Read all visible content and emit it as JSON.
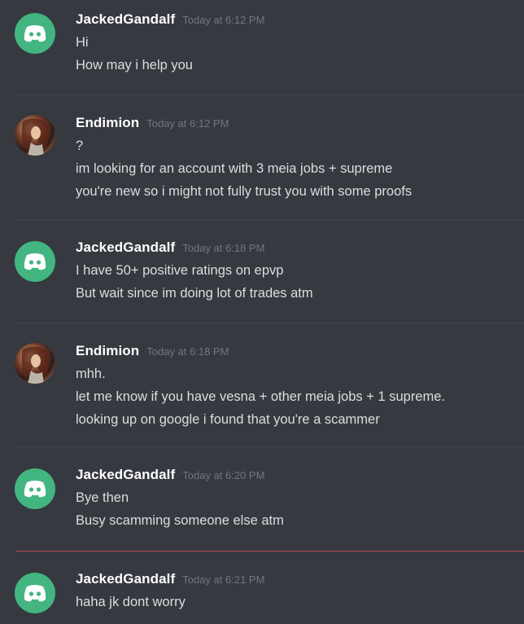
{
  "messages": [
    {
      "author": "JackedGandalf",
      "timestamp": "Today at 6:12 PM",
      "avatar": "discord-logo-icon",
      "lines": [
        "Hi",
        "How may i help you"
      ]
    },
    {
      "author": "Endimion",
      "timestamp": "Today at 6:12 PM",
      "avatar": "user-avatar",
      "lines": [
        "?",
        "im looking for an account with 3 meia jobs + supreme",
        "you're new so i might not fully trust you with some proofs"
      ]
    },
    {
      "author": "JackedGandalf",
      "timestamp": "Today at 6:18 PM",
      "avatar": "discord-logo-icon",
      "lines": [
        "I have 50+ positive ratings on epvp",
        "But wait since im doing lot of trades atm"
      ]
    },
    {
      "author": "Endimion",
      "timestamp": "Today at 6:18 PM",
      "avatar": "user-avatar",
      "lines": [
        "mhh.",
        "let me know if you have vesna + other meia jobs + 1 supreme.",
        "looking up on google i found that you're a scammer"
      ]
    },
    {
      "author": "JackedGandalf",
      "timestamp": "Today at 6:20 PM",
      "avatar": "discord-logo-icon",
      "lines": [
        "Bye then",
        "Busy scamming someone else atm"
      ]
    },
    {
      "author": "JackedGandalf",
      "timestamp": "Today at 6:21 PM",
      "avatar": "discord-logo-icon",
      "lines": [
        "haha jk dont worry"
      ]
    }
  ],
  "colors": {
    "background": "#36393f",
    "discord_avatar": "#43b581",
    "new_messages_divider": "#b94a52"
  }
}
